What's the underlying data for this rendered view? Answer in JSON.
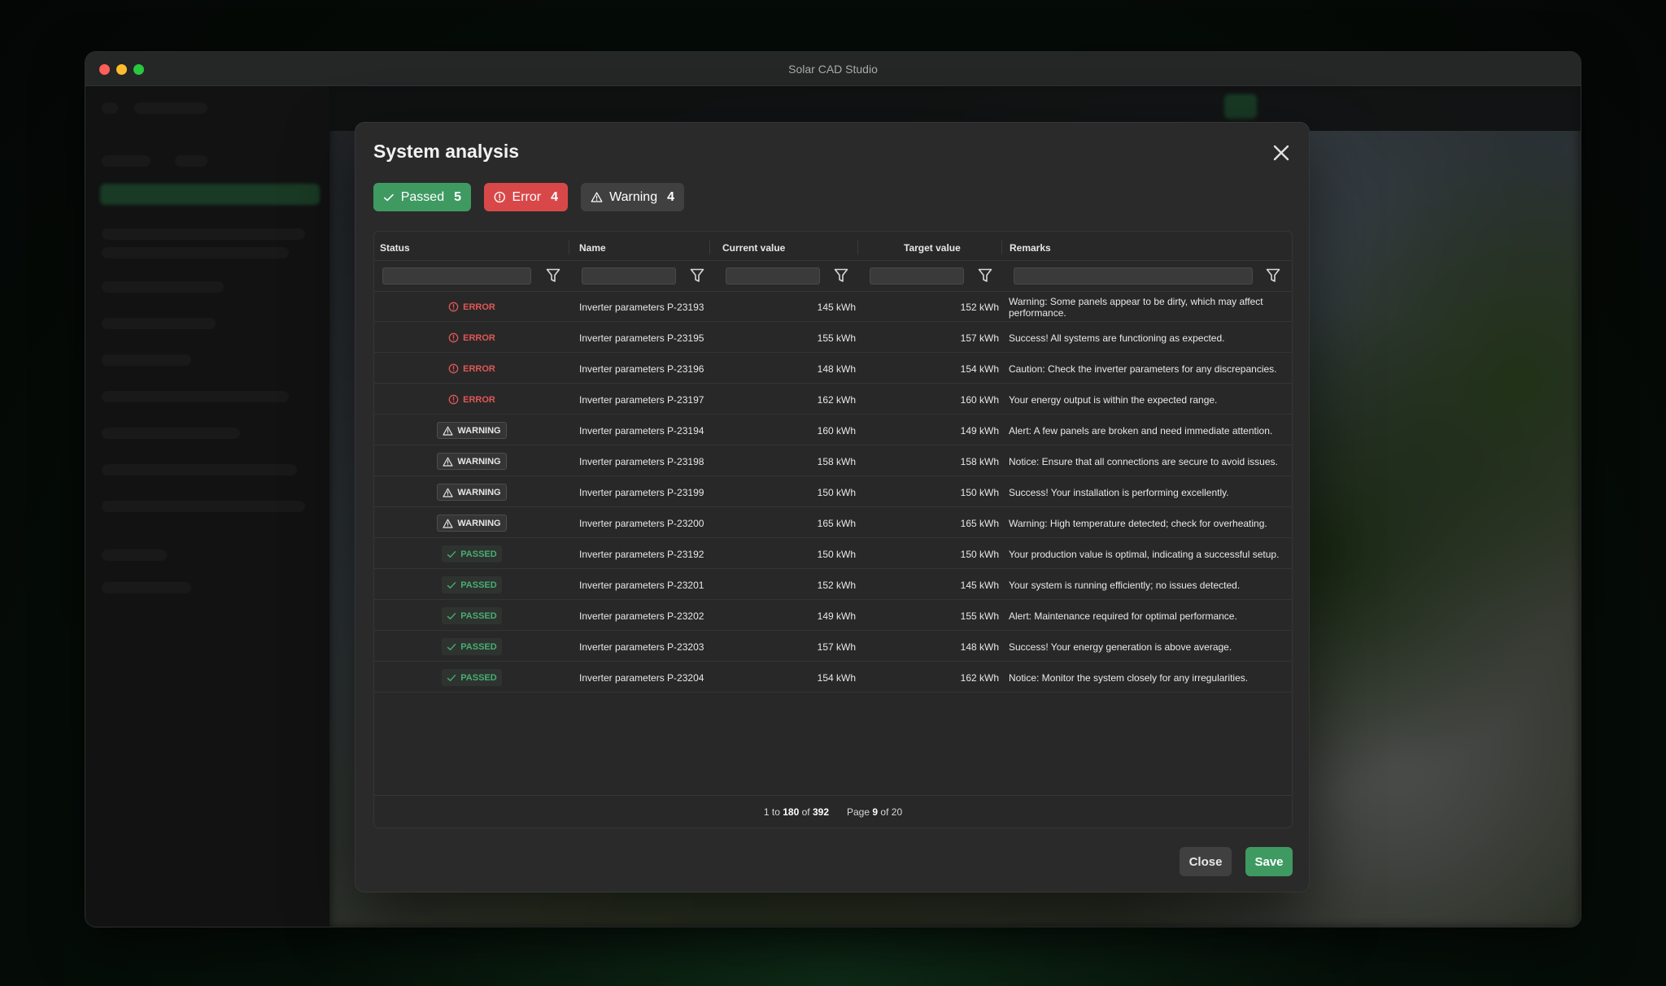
{
  "window": {
    "title": "Solar CAD Studio"
  },
  "modal": {
    "title": "System analysis",
    "chips": {
      "passed": {
        "label": "Passed",
        "count": "5"
      },
      "error": {
        "label": "Error",
        "count": "4"
      },
      "warning": {
        "label": "Warning",
        "count": "4"
      }
    },
    "columns": [
      "Status",
      "Name",
      "Current value",
      "Target value",
      "Remarks"
    ],
    "rows": [
      {
        "status": "ERROR",
        "name": "Inverter parameters P-23193",
        "current": "145 kWh",
        "target": "152 kWh",
        "remarks": "Warning: Some panels appear to be dirty, which may affect performance."
      },
      {
        "status": "ERROR",
        "name": "Inverter parameters P-23195",
        "current": "155 kWh",
        "target": "157 kWh",
        "remarks": "Success! All systems are functioning as expected."
      },
      {
        "status": "ERROR",
        "name": "Inverter parameters P-23196",
        "current": "148 kWh",
        "target": "154 kWh",
        "remarks": "Caution: Check the inverter parameters for any discrepancies."
      },
      {
        "status": "ERROR",
        "name": "Inverter parameters P-23197",
        "current": "162 kWh",
        "target": "160 kWh",
        "remarks": "Your energy output is within the expected range."
      },
      {
        "status": "WARNING",
        "name": "Inverter parameters P-23194",
        "current": "160 kWh",
        "target": "149 kWh",
        "remarks": "Alert: A few panels are broken and need immediate attention."
      },
      {
        "status": "WARNING",
        "name": "Inverter parameters P-23198",
        "current": "158 kWh",
        "target": "158 kWh",
        "remarks": "Notice: Ensure that all connections are secure to avoid issues."
      },
      {
        "status": "WARNING",
        "name": "Inverter parameters P-23199",
        "current": "150 kWh",
        "target": "150 kWh",
        "remarks": "Success! Your installation is performing excellently."
      },
      {
        "status": "WARNING",
        "name": "Inverter parameters P-23200",
        "current": "165 kWh",
        "target": "165 kWh",
        "remarks": "Warning: High temperature detected; check for overheating."
      },
      {
        "status": "PASSED",
        "name": "Inverter parameters P-23192",
        "current": "150 kWh",
        "target": "150 kWh",
        "remarks": "Your production value is optimal, indicating a successful setup."
      },
      {
        "status": "PASSED",
        "name": "Inverter parameters P-23201",
        "current": "152 kWh",
        "target": "145 kWh",
        "remarks": "Your system is running efficiently; no issues detected."
      },
      {
        "status": "PASSED",
        "name": "Inverter parameters P-23202",
        "current": "149 kWh",
        "target": "155 kWh",
        "remarks": "Alert: Maintenance required for optimal performance."
      },
      {
        "status": "PASSED",
        "name": "Inverter parameters P-23203",
        "current": "157 kWh",
        "target": "148 kWh",
        "remarks": "Success! Your energy generation is above average."
      },
      {
        "status": "PASSED",
        "name": "Inverter parameters P-23204",
        "current": "154 kWh",
        "target": "162 kWh",
        "remarks": "Notice: Monitor the system closely for any irregularities."
      }
    ],
    "pagination": {
      "range_prefix": "1 to",
      "range_end": "180",
      "of_label": "of",
      "total": "392",
      "page_label": "Page",
      "page": "9",
      "page_total": "20"
    },
    "buttons": {
      "close": "Close",
      "save": "Save"
    }
  },
  "colors": {
    "passed": "#3f9a62",
    "error": "#d94848",
    "warning": "#404040"
  },
  "icons": {
    "passed": "check-icon",
    "error": "alert-circle-icon",
    "warning": "warning-triangle-icon",
    "filter": "filter-icon",
    "close": "close-icon"
  }
}
